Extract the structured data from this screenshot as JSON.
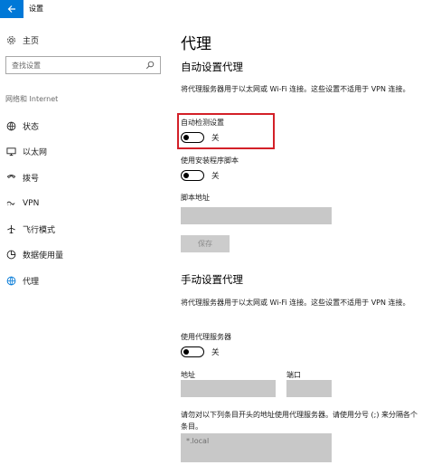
{
  "window": {
    "title": "设置",
    "back_icon": "arrow-left-icon",
    "accent": "#0078d7"
  },
  "sidebar": {
    "home_label": "主页",
    "search_placeholder": "查找设置",
    "group_label": "网络和 Internet",
    "items": [
      {
        "label": "状态",
        "icon": "globe-status-icon"
      },
      {
        "label": "以太网",
        "icon": "ethernet-monitor-icon"
      },
      {
        "label": "拨号",
        "icon": "dialup-phone-icon"
      },
      {
        "label": "VPN",
        "icon": "vpn-icon"
      },
      {
        "label": "飞行模式",
        "icon": "airplane-icon"
      },
      {
        "label": "数据使用量",
        "icon": "data-usage-icon"
      },
      {
        "label": "代理",
        "icon": "globe-icon",
        "active": true
      }
    ]
  },
  "main": {
    "page_title": "代理",
    "auto": {
      "title": "自动设置代理",
      "desc": "将代理服务器用于以太网或 Wi-Fi 连接。这些设置不适用于 VPN 连接。",
      "detect_label": "自动检测设置",
      "detect_state": "关",
      "script_label": "使用安装程序脚本",
      "script_state": "关",
      "address_label": "脚本地址",
      "save_label": "保存"
    },
    "manual": {
      "title": "手动设置代理",
      "desc": "将代理服务器用于以太网或 Wi-Fi 连接。这些设置不适用于 VPN 连接。",
      "proxy_label": "使用代理服务器",
      "proxy_state": "关",
      "address_label": "地址",
      "port_label": "端口",
      "exceptions_desc": "请勿对以下列条目开头的地址使用代理服务器。请使用分号 (;) 来分隔各个条目。",
      "exceptions_value": "*.local"
    }
  },
  "annotation": {
    "color": "#d32028"
  }
}
